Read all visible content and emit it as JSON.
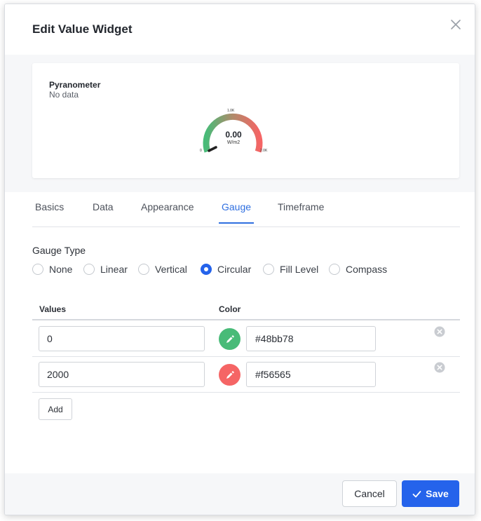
{
  "dialog": {
    "title": "Edit Value Widget"
  },
  "preview": {
    "widget_name": "Pyranometer",
    "status": "No data",
    "gauge": {
      "value": "0.00",
      "unit": "W/m2",
      "min_label": "0",
      "mid_label": "1.0K",
      "max_label": "2.0K",
      "min_color": "#48bb78",
      "max_color": "#f56565"
    }
  },
  "tabs": [
    {
      "label": "Basics",
      "active": false
    },
    {
      "label": "Data",
      "active": false
    },
    {
      "label": "Appearance",
      "active": false
    },
    {
      "label": "Gauge",
      "active": true
    },
    {
      "label": "Timeframe",
      "active": false
    }
  ],
  "gauge_type": {
    "label": "Gauge Type",
    "options": [
      "None",
      "Linear",
      "Vertical",
      "Circular",
      "Fill Level",
      "Compass"
    ],
    "selected": "Circular"
  },
  "table": {
    "headers": {
      "values": "Values",
      "color": "Color"
    },
    "rows": [
      {
        "value": "0",
        "color": "#48bb78"
      },
      {
        "value": "2000",
        "color": "#f56565"
      }
    ],
    "add_label": "Add"
  },
  "footer": {
    "cancel_label": "Cancel",
    "save_label": "Save"
  },
  "icons": {
    "close": "close-icon",
    "eyedropper": "eyedropper-icon",
    "remove": "remove-circle-icon",
    "save": "check-icon"
  },
  "colors": {
    "accent": "#2563eb",
    "green": "#48bb78",
    "red": "#f56565"
  }
}
